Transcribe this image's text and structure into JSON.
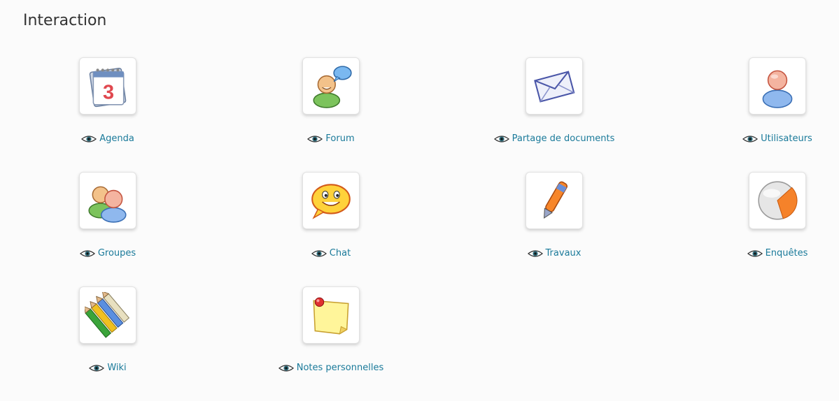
{
  "section": {
    "title": "Interaction"
  },
  "tools": [
    {
      "label": "Agenda",
      "icon": "calendar-icon"
    },
    {
      "label": "Forum",
      "icon": "forum-user-speech-icon"
    },
    {
      "label": "Partage de documents",
      "icon": "envelope-icon"
    },
    {
      "label": "Utilisateurs",
      "icon": "user-icon"
    },
    {
      "label": "Groupes",
      "icon": "group-users-icon"
    },
    {
      "label": "Chat",
      "icon": "smiley-chat-icon"
    },
    {
      "label": "Travaux",
      "icon": "pen-icon"
    },
    {
      "label": "Enquêtes",
      "icon": "pie-survey-icon"
    },
    {
      "label": "Wiki",
      "icon": "pencils-icon"
    },
    {
      "label": "Notes personnelles",
      "icon": "sticky-note-icon"
    }
  ],
  "visibility_icon": "eye-icon",
  "colors": {
    "link": "#1a7a9a",
    "title": "#333333",
    "background": "#fbfbfb"
  }
}
